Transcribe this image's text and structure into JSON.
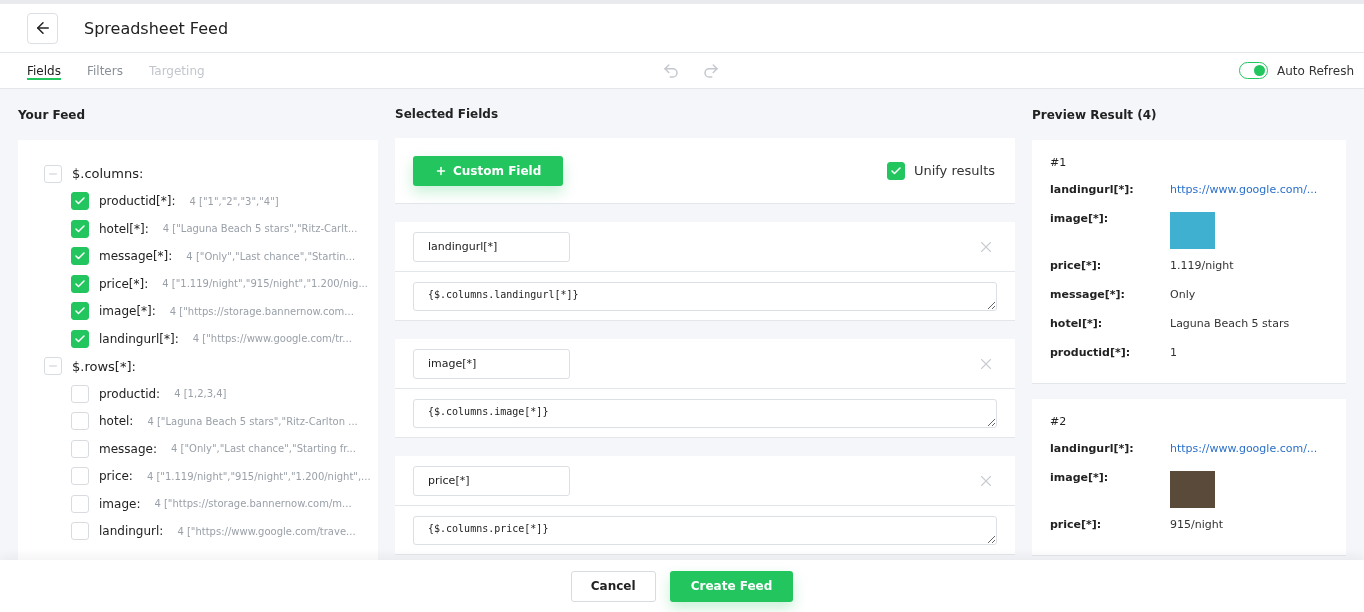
{
  "header": {
    "title": "Spreadsheet Feed"
  },
  "tabs": [
    {
      "label": "Fields",
      "selected": true,
      "disabled": false
    },
    {
      "label": "Filters",
      "selected": false,
      "disabled": false
    },
    {
      "label": "Targeting",
      "selected": false,
      "disabled": true
    }
  ],
  "auto_refresh": {
    "label": "Auto Refresh",
    "on": true
  },
  "your_feed": {
    "title": "Your Feed",
    "groups": [
      {
        "label": "$.columns:",
        "expanded": true,
        "children": [
          {
            "name": "productid[*]:",
            "summary": "4 [\"1\",\"2\",\"3\",\"4\"]",
            "checked": true
          },
          {
            "name": "hotel[*]:",
            "summary": "4 [\"Laguna Beach 5 stars\",\"Ritz-Carlt...",
            "checked": true
          },
          {
            "name": "message[*]:",
            "summary": "4 [\"Only\",\"Last chance\",\"Startin...",
            "checked": true
          },
          {
            "name": "price[*]:",
            "summary": "4 [\"1.119/night\",\"915/night\",\"1.200/nig...",
            "checked": true
          },
          {
            "name": "image[*]:",
            "summary": "4 [\"https://storage.bannernow.com...",
            "checked": true
          },
          {
            "name": "landingurl[*]:",
            "summary": "4 [\"https://www.google.com/tr...",
            "checked": true
          }
        ]
      },
      {
        "label": "$.rows[*]:",
        "expanded": true,
        "children": [
          {
            "name": "productid:",
            "summary": "4 [1,2,3,4]",
            "checked": false
          },
          {
            "name": "hotel:",
            "summary": "4 [\"Laguna Beach 5 stars\",\"Ritz-Carlton ...",
            "checked": false
          },
          {
            "name": "message:",
            "summary": "4 [\"Only\",\"Last chance\",\"Starting fr...",
            "checked": false
          },
          {
            "name": "price:",
            "summary": "4 [\"1.119/night\",\"915/night\",\"1.200/night\",...",
            "checked": false
          },
          {
            "name": "image:",
            "summary": "4 [\"https://storage.bannernow.com/m...",
            "checked": false
          },
          {
            "name": "landingurl:",
            "summary": "4 [\"https://www.google.com/trave...",
            "checked": false
          }
        ]
      }
    ]
  },
  "selected_fields": {
    "title": "Selected Fields",
    "custom_button": "Custom Field",
    "unify": {
      "label": "Unify results",
      "checked": true
    },
    "fields": [
      {
        "name": "landingurl[*]",
        "expression": "{$.columns.landingurl[*]}"
      },
      {
        "name": "image[*]",
        "expression": "{$.columns.image[*]}"
      },
      {
        "name": "price[*]",
        "expression": "{$.columns.price[*]}"
      }
    ]
  },
  "preview": {
    "title": "Preview Result (4)",
    "results": [
      {
        "index": "#1",
        "rows": [
          {
            "key": "landingurl[*]:",
            "kind": "link",
            "value": "https://www.google.com/..."
          },
          {
            "key": "image[*]:",
            "kind": "image",
            "color": "#3fb0d0"
          },
          {
            "key": "price[*]:",
            "kind": "text",
            "value": "1.119/night"
          },
          {
            "key": "message[*]:",
            "kind": "text",
            "value": "Only"
          },
          {
            "key": "hotel[*]:",
            "kind": "text",
            "value": "Laguna Beach 5 stars"
          },
          {
            "key": "productid[*]:",
            "kind": "text",
            "value": "1"
          }
        ]
      },
      {
        "index": "#2",
        "rows": [
          {
            "key": "landingurl[*]:",
            "kind": "link",
            "value": "https://www.google.com/..."
          },
          {
            "key": "image[*]:",
            "kind": "image",
            "color": "#5a4a3a"
          },
          {
            "key": "price[*]:",
            "kind": "text",
            "value": "915/night"
          }
        ]
      }
    ]
  },
  "footer": {
    "cancel": "Cancel",
    "create": "Create Feed"
  }
}
